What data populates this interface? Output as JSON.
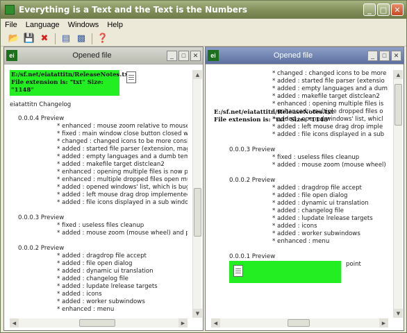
{
  "app": {
    "title": "Everything is a Text and the Text is the Numbers",
    "window_buttons": {
      "minimize": "_",
      "maximize": "□",
      "close": "✕"
    }
  },
  "menu": [
    "File",
    "Language",
    "Windows",
    "Help"
  ],
  "toolbar": {
    "icons": [
      "open-icon",
      "save-icon",
      "close-red-x-icon",
      "tile-windows-icon",
      "cascade-windows-icon",
      "help-icon"
    ]
  },
  "left_window": {
    "title": "Opened file",
    "file_path": "E:/sf.net/eiatattitn/ReleaseNotes.txt",
    "file_info": "File extension is:  \"txt\"  Size: \"1148\"",
    "heading": "eiatattitn Changelog",
    "sections": [
      {
        "version": "0.0.0.4 Preview",
        "items": [
          "* enhanced : mouse zoom relative to mouse p",
          "* fixed : main window close button closed wit",
          "* changed : changed icons to be more consist",
          "* added : started file parser (extension, magic",
          "* added : empty languages and a dumb tempo",
          "* added : makefile target distclean2",
          "* enhanced : opening multiple files is now po",
          "* enhanced : multiple dropped files open mult",
          "* added : opened windows' list, which is bugg",
          "* added : left mouse drag drop implemented",
          "* added : file icons displayed in a sub window"
        ]
      },
      {
        "version": "0.0.0.3 Preview",
        "items": [
          "* fixed : useless files cleanup",
          "* added : mouse zoom (mouse wheel) and pa"
        ]
      },
      {
        "version": "0.0.0.2 Preview",
        "items": [
          "* added : dragdrop file accept",
          "* added : file open dialog",
          "* added : dynamic ui translation",
          "* added : changelog file",
          "* added : lupdate lrelease targets",
          "* added : icons",
          "* added : worker subwindows",
          "* enhanced : menu"
        ]
      }
    ]
  },
  "right_window": {
    "title": "Opened file",
    "file_path": "E:/sf.net/eiatattitn/ReleaseNotes.txt",
    "file_info": "File extension is:  \"txt\"  Size: \"1148\"",
    "top_items": [
      "* changed : changed icons to be more",
      "* added : started file parser (extensio",
      "* added : empty languages and a dum",
      "* added : makefile target distclean2",
      "* enhanced : opening multiple files is",
      "* enhanced : multiple dropped files o",
      "* added : opened windows' list, whicl",
      "* added : left mouse drag drop imple",
      "* added : file icons displayed in a sub"
    ],
    "sections": [
      {
        "version": "0.0.0.3 Preview",
        "items": [
          "* fixed : useless files cleanup",
          "* added : mouse zoom (mouse wheel)"
        ]
      },
      {
        "version": "0.0.0.2 Preview",
        "items": [
          "* added : dragdrop file accept",
          "* added : file open dialog",
          "* added : dynamic ui translation",
          "* added : changelog file",
          "* added : lupdate lrelease targets",
          "* added : icons",
          "* added : worker subwindows",
          "* enhanced : menu"
        ]
      }
    ],
    "last_version": "0.0.0.1 Preview",
    "last_item_tail": "point"
  },
  "colors": {
    "titlebar": "#818e5a",
    "active_subwindow": "#5c6f9f",
    "fileinfo_highlight": "#22ee22"
  }
}
